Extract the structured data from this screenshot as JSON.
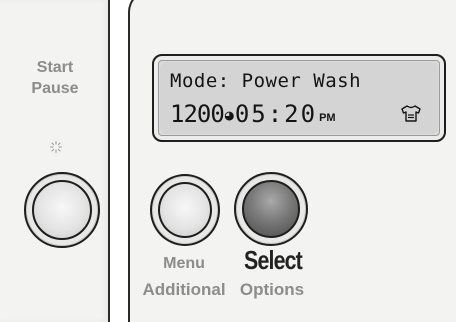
{
  "left_panel": {
    "start_label": "Start",
    "pause_label": "Pause",
    "indicator_icon": "sparkle-light-icon"
  },
  "display": {
    "line1": "Mode: Power Wash",
    "temperature": "1200",
    "clock_icon": "clock-icon",
    "time": "05:20",
    "ampm": "PM",
    "shirt_icon": "shirt-icon"
  },
  "buttons": {
    "menu_label": "Menu",
    "additional_label": "Additional",
    "select_label": "Select",
    "options_label": "Options"
  },
  "colors": {
    "panel_bg": "#f3f3f1",
    "label_gray": "#8c8c8c",
    "select_dark": "#222222",
    "lcd_bg": "#d4d4d4",
    "outline": "#1e1e1e"
  }
}
